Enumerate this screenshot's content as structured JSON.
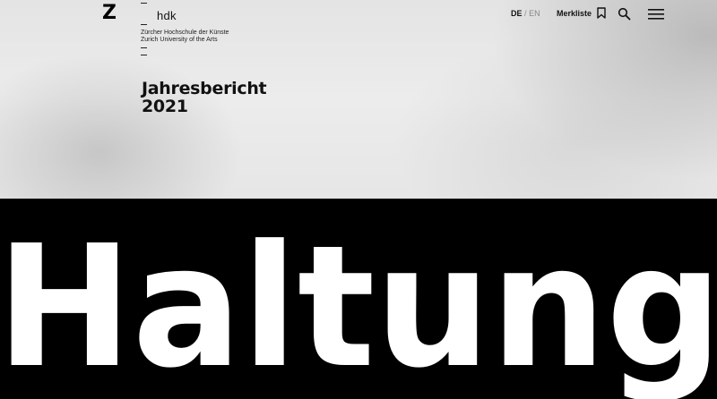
{
  "header": {
    "logo_mark": "Z",
    "institution": {
      "short": "hdk",
      "name_de": "Zürcher Hochschule der Künste",
      "name_en": "Zurich University of the Arts"
    },
    "language": {
      "active": "DE",
      "separator": "/",
      "other": "EN"
    },
    "merkliste_label": "Merkliste"
  },
  "hero": {
    "title_line1": "Jahresbericht",
    "title_line2": "2021"
  },
  "banner": {
    "word": "Haltung"
  }
}
